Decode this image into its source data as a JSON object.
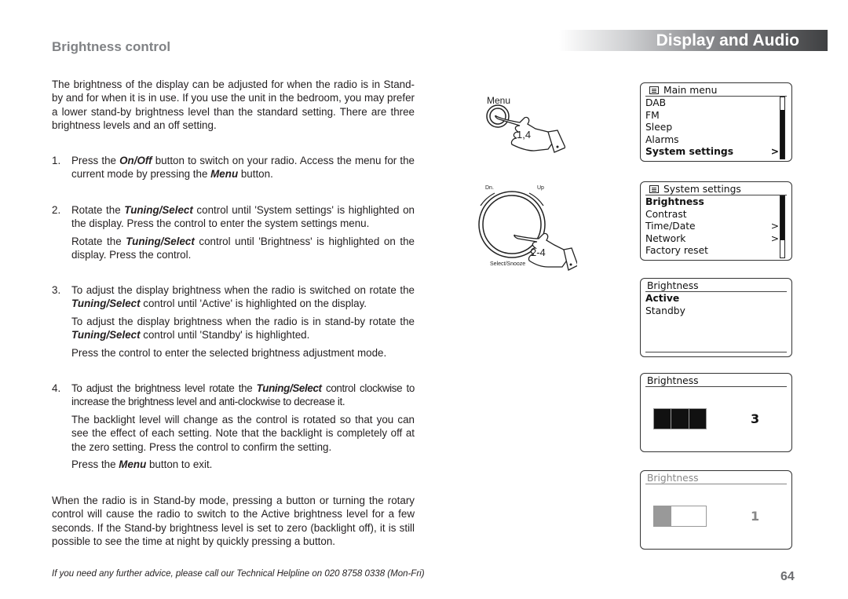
{
  "section_title": "Brightness control",
  "chapter_title": "Display and Audio",
  "intro": "The brightness of the display can be adjusted for when the radio is in Stand-by and for when it is in use. If you use the unit in the bedroom, you may prefer a lower stand-by brightness level than the standard setting. There are three brightness levels and an off setting.",
  "steps": [
    {
      "num": "1.",
      "paras": [
        {
          "a": "Press the ",
          "b": "On/Off",
          "c": " button to switch on your radio. Access the menu for the current mode by pressing the ",
          "d": "Menu",
          "e": " button."
        }
      ]
    },
    {
      "num": "2.",
      "paras": [
        {
          "a": "Rotate the ",
          "b": "Tuning/Select",
          "c": " control until 'System settings' is highlighted on the display. Press the control to enter the system settings menu."
        },
        {
          "a": "Rotate the ",
          "b": "Tuning/Select",
          "c": " control until 'Brightness' is highlighted on the display. Press the control."
        }
      ]
    },
    {
      "num": "3.",
      "paras": [
        {
          "a": "To adjust the display brightness when the radio is switched on rotate the ",
          "b": "Tuning/Select",
          "c": " control until 'Active' is highlighted on the display."
        },
        {
          "a": "To adjust the display brightness when the radio is in stand-by rotate the ",
          "b": "Tuning/Select",
          "c": " control until 'Standby' is highlighted."
        },
        {
          "a": "Press the control to enter the selected brightness adjustment mode."
        }
      ]
    },
    {
      "num": "4.",
      "paras": [
        {
          "a": "To adjust the brightness level rotate the ",
          "b": "Tuning/Select",
          "c": " control clockwise to increase the brightness level and anti-clockwise to decrease it."
        },
        {
          "a": "The backlight level will change as the control is rotated so that you can see the effect of each setting. Note that the backlight is completely off at the zero setting. Press the control to confirm the setting."
        },
        {
          "a": "Press the ",
          "b": "Menu",
          "c": " button to exit."
        }
      ]
    }
  ],
  "closing": "When the radio is in Stand-by mode, pressing a button or turning the rotary control will cause the radio to switch to the Active brightness level for a few seconds. If the Stand-by brightness level is set to zero (backlight off), it is still possible to see the time at night by quickly pressing a button.",
  "footer_note": "If you need any further advice, please call our Technical Helpline on 020 8758 0338 (Mon-Fri)",
  "page_number": "64",
  "diagrams": {
    "menu_button": {
      "label": "Menu",
      "steps": "1,4"
    },
    "dial": {
      "down_label": "Dn.",
      "up_label": "Up",
      "bottom_label": "Select/Snooze",
      "steps": "2-4"
    }
  },
  "screens": {
    "main_menu": {
      "title": "Main menu",
      "items": [
        {
          "label": "DAB",
          "arrow": ""
        },
        {
          "label": "FM",
          "arrow": ""
        },
        {
          "label": "Sleep",
          "arrow": ""
        },
        {
          "label": "Alarms",
          "arrow": ""
        },
        {
          "label": "System settings",
          "arrow": ">"
        }
      ]
    },
    "system_settings": {
      "title": "System settings",
      "items": [
        {
          "label": "Brightness",
          "arrow": ""
        },
        {
          "label": "Contrast",
          "arrow": ""
        },
        {
          "label": "Time/Date",
          "arrow": ">"
        },
        {
          "label": "Network",
          "arrow": ">"
        },
        {
          "label": "Factory reset",
          "arrow": ""
        }
      ]
    },
    "brightness_mode": {
      "title": "Brightness",
      "items": [
        {
          "label": "Active"
        },
        {
          "label": "Standby"
        }
      ]
    },
    "brightness_active": {
      "title": "Brightness",
      "level": "3",
      "max_level": 3
    },
    "brightness_standby": {
      "title": "Brightness",
      "level": "1",
      "max_level": 3
    }
  }
}
